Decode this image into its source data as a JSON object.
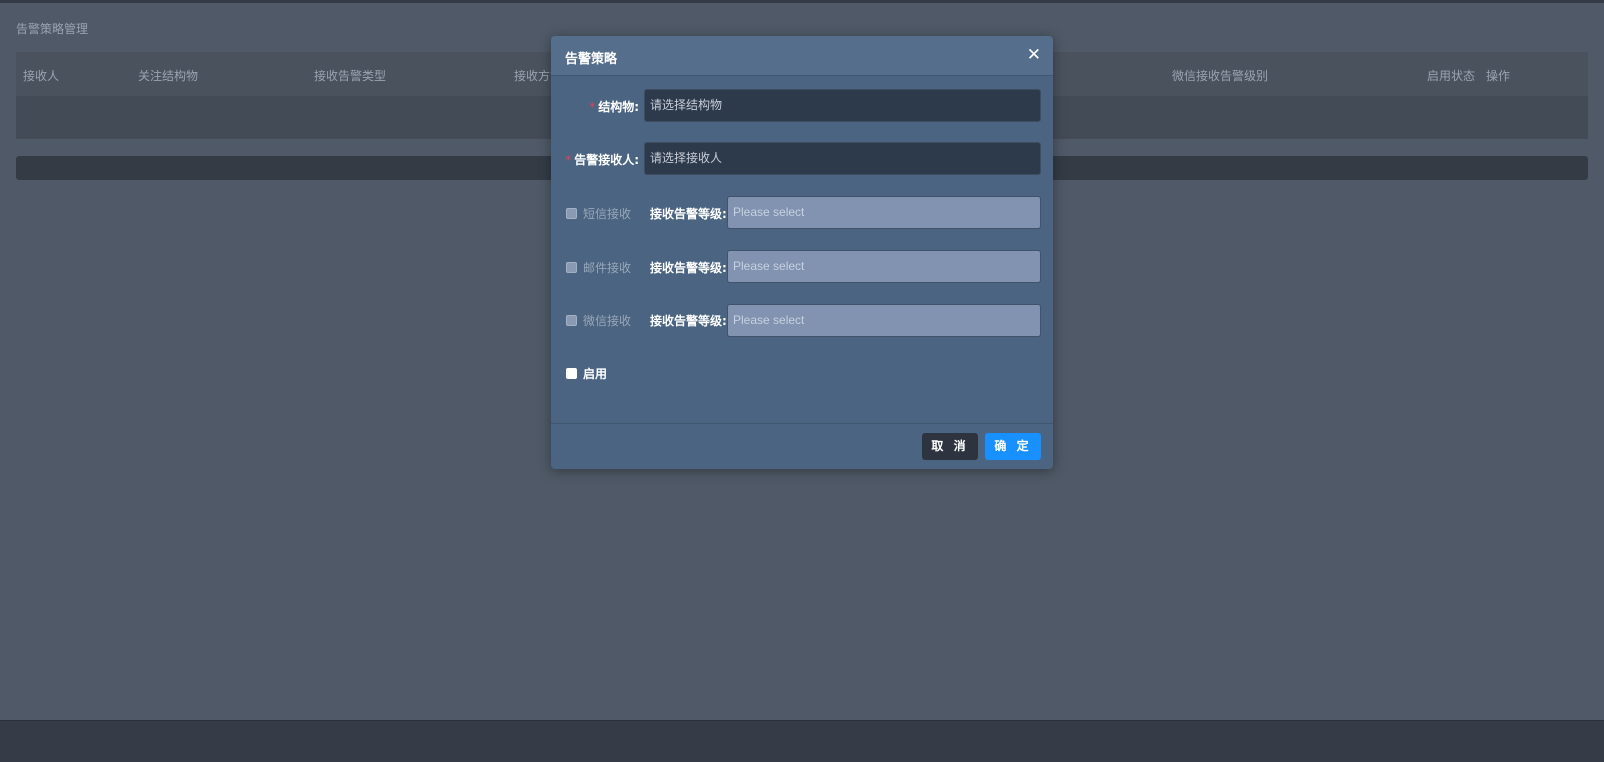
{
  "page": {
    "title": "告警策略管理"
  },
  "table": {
    "columns": [
      "接收人",
      "关注结构物",
      "接收告警类型",
      "接收方式",
      "微信接收告警级别",
      "启用状态",
      "操作"
    ]
  },
  "modal": {
    "title": "告警策略",
    "close_icon": "close-icon",
    "fields": {
      "structure": {
        "required_mark": "*",
        "label": "结构物:",
        "placeholder": "请选择结构物"
      },
      "receiver": {
        "required_mark": "*",
        "label": "告警接收人:",
        "placeholder": "请选择接收人"
      }
    },
    "channels": [
      {
        "label": "短信接收",
        "level_label": "接收告警等级:",
        "placeholder": "Please select",
        "checked": false
      },
      {
        "label": "邮件接收",
        "level_label": "接收告警等级:",
        "placeholder": "Please select",
        "checked": false
      },
      {
        "label": "微信接收",
        "level_label": "接收告警等级:",
        "placeholder": "Please select",
        "checked": false
      }
    ],
    "enable": {
      "label": "启用",
      "checked": false
    },
    "buttons": {
      "cancel": "取 消",
      "ok": "确 定"
    }
  },
  "colors": {
    "background": "#4f5967",
    "modal": "#4a6482",
    "primary": "#1890ff",
    "required": "#e0425a"
  }
}
